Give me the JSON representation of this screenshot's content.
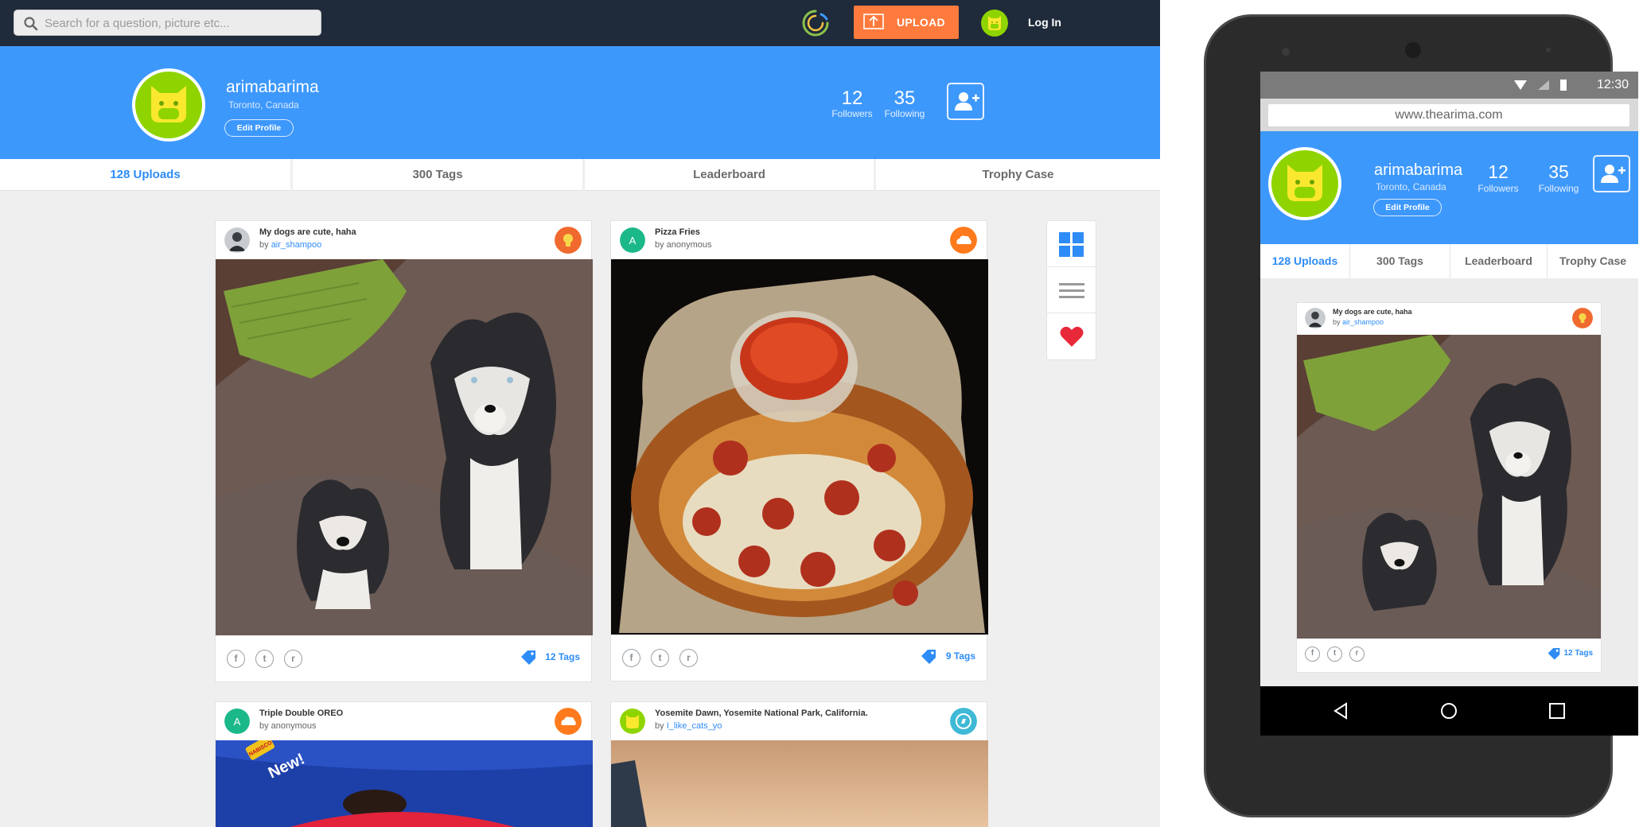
{
  "desktop": {
    "search_placeholder": "Search for a question, picture etc...",
    "upload_label": "UPLOAD",
    "login_label": "Log In",
    "profile": {
      "name": "arimabarima",
      "location": "Toronto, Canada",
      "edit_label": "Edit Profile",
      "followers_count": "12",
      "followers_label": "Followers",
      "following_count": "35",
      "following_label": "Following"
    },
    "tabs": [
      "128 Uploads",
      "300 Tags",
      "Leaderboard",
      "Trophy Case"
    ],
    "cards": [
      {
        "title": "My dogs are cute, haha",
        "by": "by ",
        "author": "air_shampoo",
        "tags": "12 Tags",
        "badge_icon": "lightbulb-icon",
        "badge_color": "#f0692e"
      },
      {
        "title": "Pizza Fries",
        "by": "by anonymous",
        "author": "",
        "tags": "9 Tags",
        "badge_icon": "cloud-icon",
        "badge_color": "#ff7a1c"
      },
      {
        "title": "Triple Double OREO",
        "by": "by anonymous",
        "author": "",
        "tags": "",
        "badge_icon": "cloud-icon",
        "badge_color": "#ff7a1c"
      },
      {
        "title": "Yosemite Dawn, Yosemite National Park, California.",
        "by": "by ",
        "author": "I_like_cats_yo",
        "tags": "",
        "badge_icon": "compass-icon",
        "badge_color": "#3fb9d6"
      }
    ],
    "avatar_letter": "A",
    "oreo_text": "New!",
    "oreo_brand": "NABISCO",
    "colors": {
      "nav": "#1f2a3a",
      "brand_blue": "#3d98fc",
      "accent_orange": "#ff7a3d",
      "avatar_green": "#8fd400",
      "heart_red": "#e8293a"
    }
  },
  "phone": {
    "time": "12:30",
    "url": "www.thearima.com",
    "profile": {
      "name": "arimabarima",
      "location": "Toronto, Canada",
      "edit_label": "Edit Profile",
      "followers_count": "12",
      "followers_label": "Followers",
      "following_count": "35",
      "following_label": "Following"
    },
    "tabs": [
      "128 Uploads",
      "300 Tags",
      "Leaderboard",
      "Trophy Case"
    ],
    "card": {
      "title": "My dogs are cute, haha",
      "by": "by ",
      "author": "air_shampoo",
      "tags": "12 Tags"
    }
  }
}
